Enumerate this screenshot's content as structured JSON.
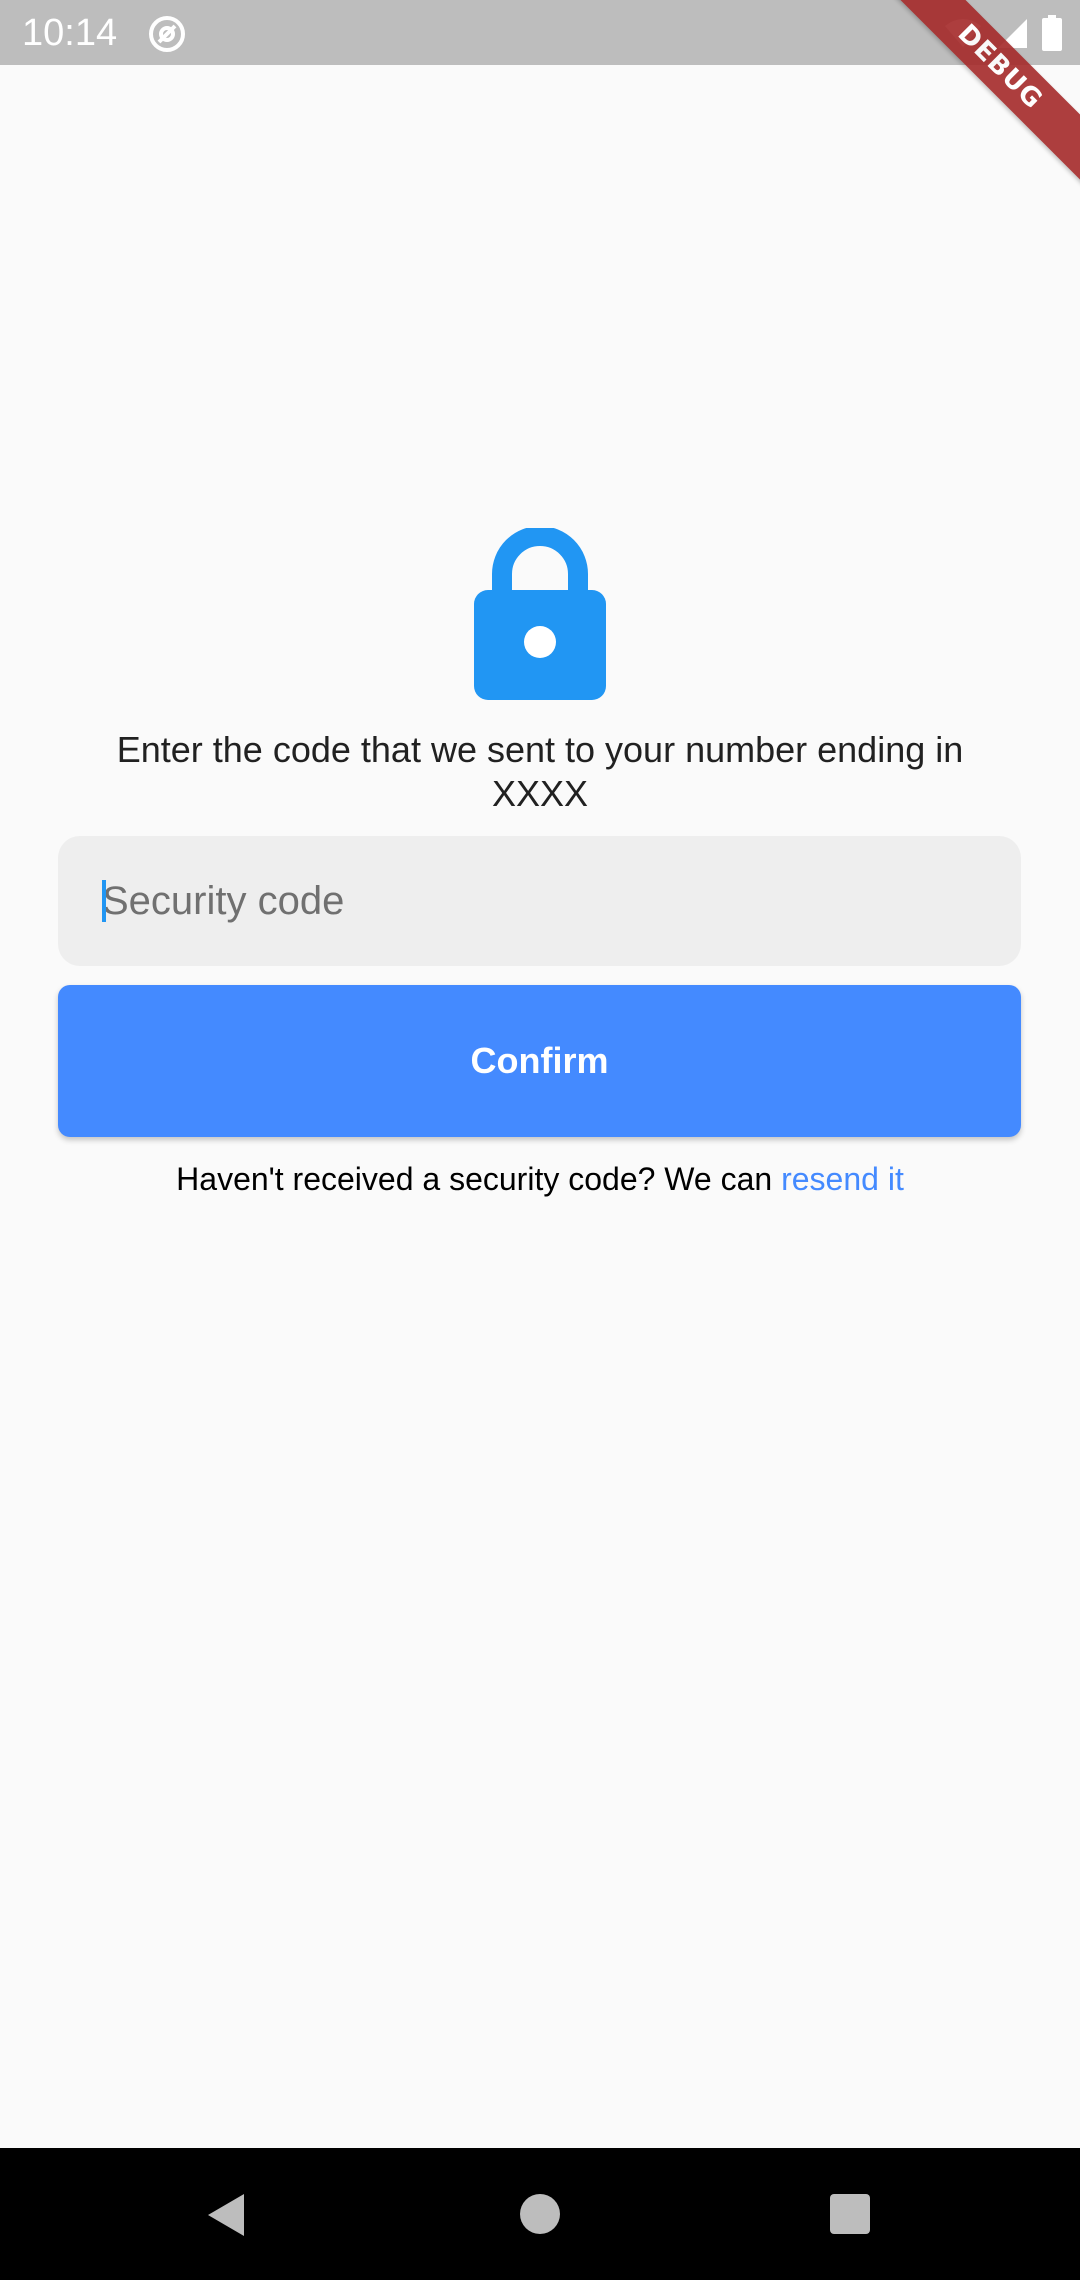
{
  "status_bar": {
    "time": "10:14",
    "icons": [
      "at-sign-icon",
      "wifi-icon",
      "signal-icon",
      "battery-icon"
    ]
  },
  "debug_banner": {
    "label": "DEBUG"
  },
  "content": {
    "icon": "lock-icon",
    "instruction": "Enter the code that we sent to your number ending in XXXX",
    "code_field": {
      "placeholder": "Security code",
      "value": ""
    },
    "confirm_label": "Confirm",
    "resend_prefix": "Haven't received a security code? We can ",
    "resend_link": "resend it"
  },
  "nav_bar": {
    "buttons": [
      "back-icon",
      "home-icon",
      "recents-icon"
    ]
  },
  "colors": {
    "accent": "#448aff",
    "lock": "#2196f3",
    "status_bar": "#bdbdbd",
    "debug_ribbon": "#a52a2a"
  }
}
